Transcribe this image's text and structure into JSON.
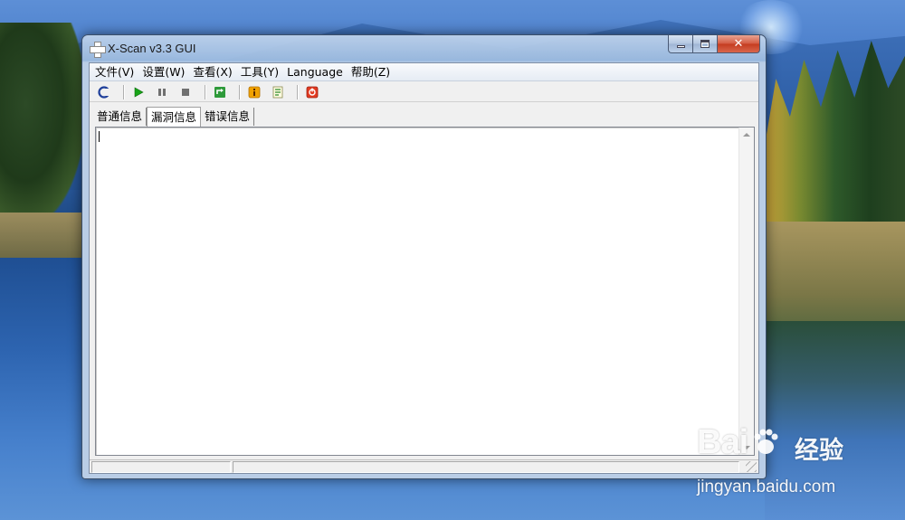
{
  "window": {
    "title": "X-Scan v3.3 GUI"
  },
  "menubar": {
    "items": [
      "文件(V)",
      "设置(W)",
      "查看(X)",
      "工具(Y)",
      "Language",
      "帮助(Z)"
    ]
  },
  "toolbar": {
    "buttons": [
      "connect-icon",
      "play-icon",
      "pause-icon",
      "stop-icon",
      "refresh-icon",
      "info-icon",
      "report-icon",
      "exit-icon"
    ]
  },
  "tabs": {
    "items": [
      "普通信息",
      "漏洞信息",
      "错误信息"
    ],
    "active_index": 1
  },
  "content": {
    "text": ""
  },
  "statusbar": {
    "pane1": "",
    "pane2": ""
  },
  "watermark": {
    "logo": "Bai",
    "logo_suffix": "经验",
    "url": "jingyan.baidu.com"
  },
  "colors": {
    "close_button": "#c43b1f",
    "titlebar": "#a8c0e0",
    "client_bg": "#f0f0f0"
  }
}
